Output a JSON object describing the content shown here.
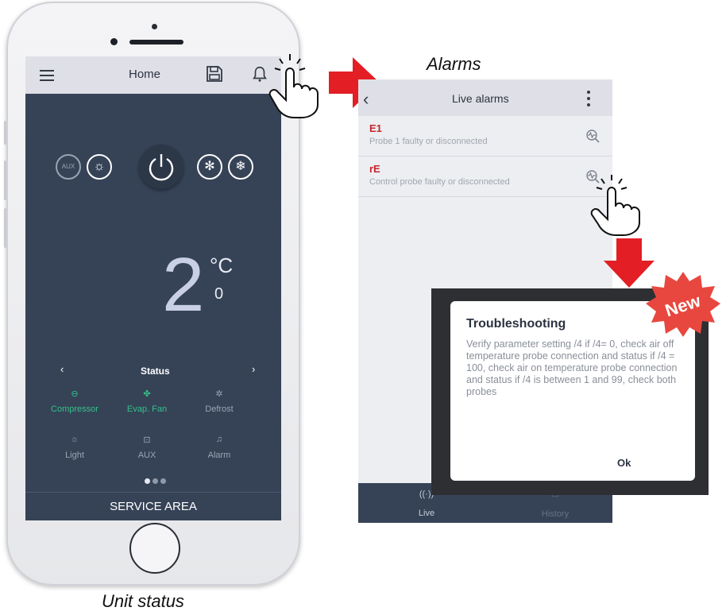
{
  "captions": {
    "unit_status": "Unit status",
    "alarms": "Alarms"
  },
  "home": {
    "title": "Home",
    "temperature": {
      "value": "2",
      "decimal": "0",
      "unit": "°C"
    },
    "status": {
      "label": "Status",
      "items": [
        "Compressor",
        "Evap. Fan",
        "Defrost",
        "Light",
        "AUX",
        "Alarm"
      ]
    },
    "service_area": "SERVICE AREA"
  },
  "alarms_screen": {
    "title": "Live alarms",
    "alarms": [
      {
        "code": "E1",
        "description": "Probe 1 faulty or disconnected"
      },
      {
        "code": "rE",
        "description": "Control probe faulty or disconnected"
      }
    ],
    "tabs": {
      "live": "Live",
      "history": "History"
    }
  },
  "dialog": {
    "title": "Troubleshooting",
    "body": "Verify parameter setting /4 if /4= 0, check air off temperature probe connection and status if /4 = 100, check air on temperature probe connection and status if /4 is between 1 and 99, check both probes",
    "ok": "Ok",
    "badge": "New"
  },
  "colors": {
    "screen_bg": "#364357",
    "alarm_red": "#c6262c",
    "active_green": "#33c087",
    "arrow_red": "#e31e24"
  }
}
